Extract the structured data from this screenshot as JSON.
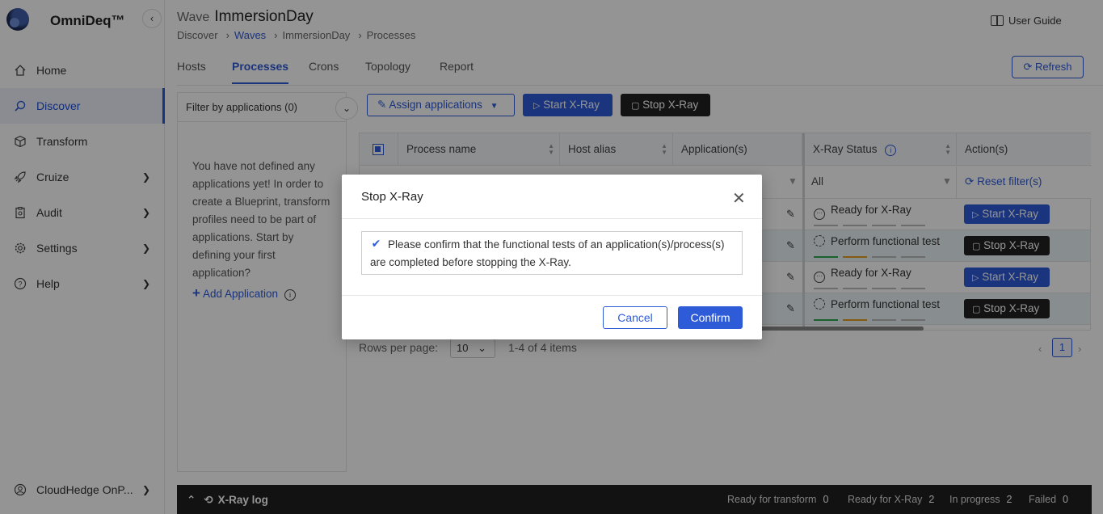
{
  "app": {
    "brand": "OmniDeq™",
    "collapse_icon": "chevron-left-icon"
  },
  "sidebar": {
    "items": [
      {
        "label": "Home",
        "icon": "home-icon",
        "chevron": false
      },
      {
        "label": "Discover",
        "icon": "search-icon",
        "chevron": false,
        "active": true
      },
      {
        "label": "Transform",
        "icon": "cube-icon",
        "chevron": false
      },
      {
        "label": "Cruize",
        "icon": "rocket-icon",
        "chevron": true
      },
      {
        "label": "Audit",
        "icon": "clipboard-icon",
        "chevron": true
      },
      {
        "label": "Settings",
        "icon": "gear-icon",
        "chevron": true
      },
      {
        "label": "Help",
        "icon": "help-icon",
        "chevron": true
      }
    ],
    "account": "CloudHedge OnP..."
  },
  "header": {
    "wave_label": "Wave",
    "wave_name": "ImmersionDay",
    "breadcrumb": [
      "Discover",
      "Waves",
      "ImmersionDay",
      "Processes"
    ],
    "user_guide": "User Guide"
  },
  "tabs": [
    "Hosts",
    "Processes",
    "Crons",
    "Topology",
    "Report"
  ],
  "refresh_label": "Refresh",
  "filter": {
    "label": "Filter by applications (0)",
    "empty_message": "You have not defined any applications yet! In order to create a Blueprint, transform profiles need to be part of applications. Start by defining your first application?",
    "add_label": "Add Application"
  },
  "toolbar": {
    "assign": "Assign applications",
    "start": "Start X-Ray",
    "stop": "Stop X-Ray"
  },
  "table": {
    "columns": [
      "Process name",
      "Host alias",
      "Application(s)",
      "X-Ray Status",
      "Action(s)"
    ],
    "status_filter": "All",
    "reset_filter": "Reset filter(s)",
    "rows": [
      {
        "status": "Ready for X-Ray",
        "action": "Start X-Ray"
      },
      {
        "status": "Perform functional test",
        "action": "Stop X-Ray"
      },
      {
        "status": "Ready for X-Ray",
        "action": "Start X-Ray"
      },
      {
        "status": "Perform functional test",
        "action": "Stop X-Ray"
      }
    ]
  },
  "pager": {
    "rows_per_page_label": "Rows per page:",
    "rows_per_page": "10",
    "count": "1-4 of 4 items",
    "page": "1"
  },
  "xray_log": {
    "title": "X-Ray log",
    "stats": [
      {
        "label": "Ready for transform",
        "value": "0"
      },
      {
        "label": "Ready for X-Ray",
        "value": "2"
      },
      {
        "label": "In progress",
        "value": "2"
      },
      {
        "label": "Failed",
        "value": "0"
      }
    ]
  },
  "modal": {
    "title": "Stop X-Ray",
    "confirm_text": "Please confirm that the functional tests of an application(s)/process(s) are completed before stopping the X-Ray.",
    "checked": true,
    "cancel": "Cancel",
    "confirm": "Confirm"
  },
  "colors": {
    "accent": "#2e5bd8",
    "dark_button": "#222222",
    "row_highlight": "#eaf3f7",
    "status_green": "#2fa84f",
    "status_orange": "#e39b1f"
  }
}
